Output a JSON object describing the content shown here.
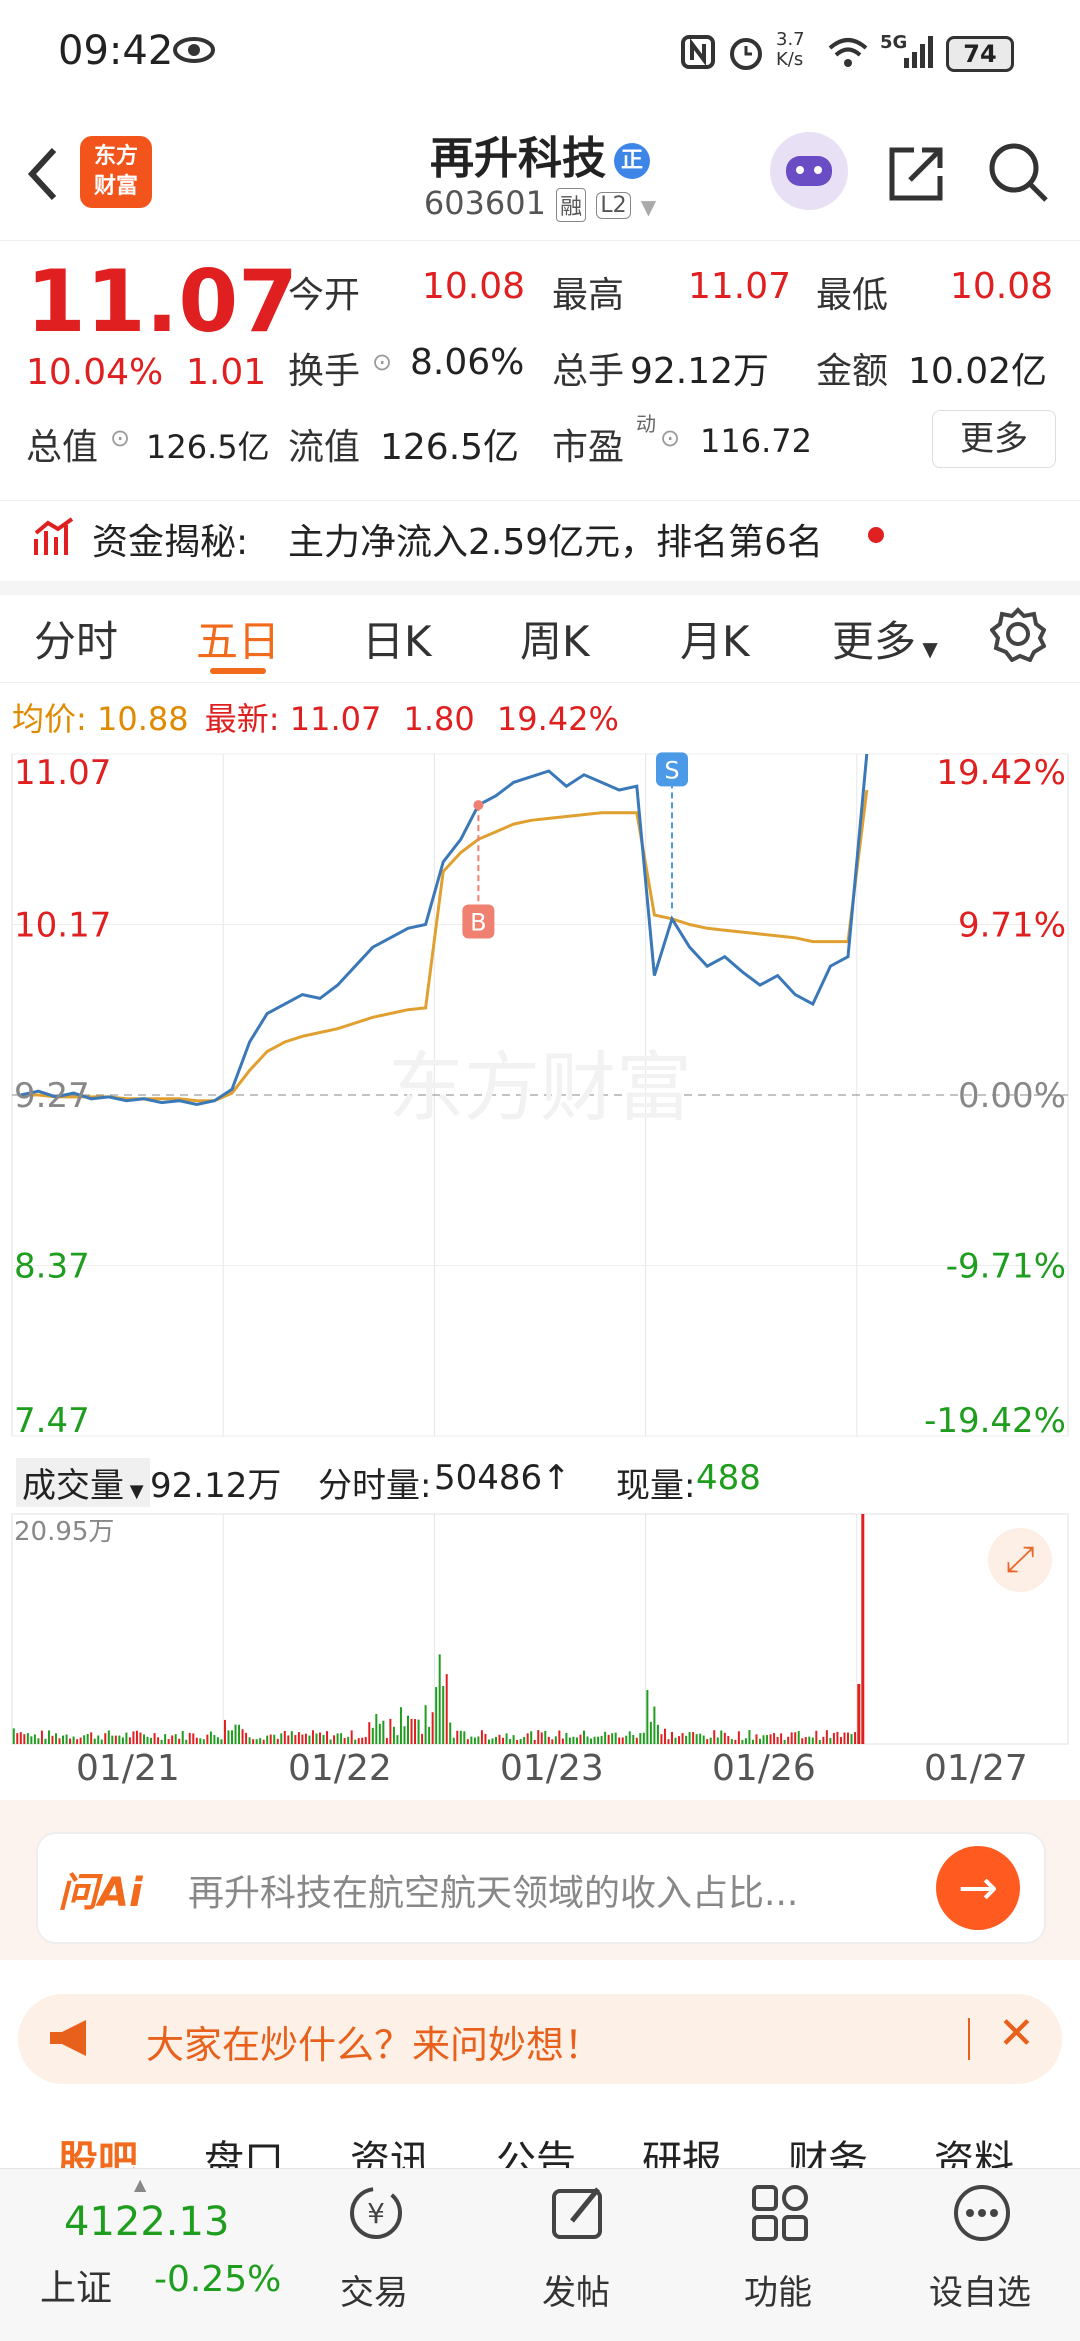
{
  "status": {
    "time": "09:42",
    "net_speed": "3.7\nK/s",
    "battery": "74",
    "signal": "5G"
  },
  "header": {
    "name": "再升科技",
    "badge": "正",
    "code": "603601",
    "tag_rong": "融",
    "tag_l2": "L2",
    "logo_line1": "东方",
    "logo_line2": "财富"
  },
  "quote": {
    "price": "11.07",
    "change_pct": "10.04%",
    "change": "1.01",
    "open_label": "今开",
    "open": "10.08",
    "high_label": "最高",
    "high": "11.07",
    "low_label": "最低",
    "low": "10.08",
    "turnover_label": "换手",
    "turnover": "8.06%",
    "volume_label": "总手",
    "volume": "92.12万",
    "amount_label": "金额",
    "amount": "10.02亿",
    "mktcap_label": "总值",
    "mktcap": "126.5亿",
    "float_label": "流值",
    "float": "126.5亿",
    "pe_label": "市盈",
    "pe_sup": "动",
    "pe": "116.72",
    "more": "更多"
  },
  "fund": {
    "label": "资金揭秘:",
    "text": "主力净流入2.59亿元，排名第6名"
  },
  "tabs": [
    "分时",
    "五日",
    "日K",
    "周K",
    "月K",
    "更多"
  ],
  "chart_info": {
    "avg_label": "均价:",
    "avg": "10.88",
    "last_label": "最新:",
    "last": "11.07",
    "chg": "1.80",
    "chg_pct": "19.42%"
  },
  "chart_data": {
    "type": "line",
    "x": [
      "01/21",
      "01/22",
      "01/23",
      "01/26",
      "01/27"
    ],
    "y_labels_left": [
      "11.07",
      "10.17",
      "9.27",
      "8.37",
      "7.47"
    ],
    "y_labels_right": [
      "19.42%",
      "9.71%",
      "0.00%",
      "-9.71%",
      "-19.42%"
    ],
    "ylim": [
      7.47,
      11.07
    ],
    "base": 9.27,
    "series": [
      {
        "name": "price",
        "values": [
          9.27,
          9.29,
          9.26,
          9.28,
          9.25,
          9.26,
          9.24,
          9.25,
          9.23,
          9.24,
          9.22,
          9.24,
          9.3,
          9.55,
          9.7,
          9.75,
          9.8,
          9.78,
          9.85,
          9.95,
          10.05,
          10.1,
          10.15,
          10.17,
          10.5,
          10.62,
          10.8,
          10.85,
          10.92,
          10.95,
          10.98,
          10.9,
          10.96,
          10.92,
          10.88,
          10.9,
          9.9,
          10.2,
          10.05,
          9.95,
          10.0,
          9.92,
          9.85,
          9.9,
          9.8,
          9.75,
          9.95,
          10.0,
          11.07
        ]
      },
      {
        "name": "avg",
        "values": [
          9.27,
          9.27,
          9.26,
          9.26,
          9.26,
          9.26,
          9.25,
          9.25,
          9.25,
          9.25,
          9.24,
          9.24,
          9.28,
          9.4,
          9.5,
          9.55,
          9.58,
          9.6,
          9.62,
          9.65,
          9.68,
          9.7,
          9.72,
          9.73,
          10.45,
          10.55,
          10.62,
          10.66,
          10.7,
          10.72,
          10.73,
          10.74,
          10.75,
          10.76,
          10.76,
          10.76,
          10.22,
          10.2,
          10.17,
          10.15,
          10.14,
          10.13,
          10.12,
          10.11,
          10.1,
          10.08,
          10.08,
          10.08,
          10.88
        ]
      }
    ],
    "markers": [
      {
        "label": "B",
        "color": "#f08070"
      },
      {
        "label": "S",
        "color": "#4a9ae8"
      }
    ],
    "watermark": "东方财富"
  },
  "volume": {
    "label": "成交量",
    "total": "92.12万",
    "min_label": "分时量:",
    "min_val": "50486↑",
    "now_label": "现量:",
    "now_val": "488",
    "max": "20.95万",
    "dates": [
      "01/21",
      "01/22",
      "01/23",
      "01/26",
      "01/27"
    ]
  },
  "ai": {
    "logo": "问Ai",
    "placeholder": "再升科技在航空航天领域的收入占比..."
  },
  "hot": {
    "text": "大家在炒什么？来问妙想！"
  },
  "nav_tabs": [
    "股吧",
    "盘口",
    "资讯",
    "公告",
    "研报",
    "财务",
    "资料"
  ],
  "bottom": {
    "index_value": "4122.13",
    "index_name": "上证",
    "index_change": "-0.25%",
    "items": [
      "交易",
      "发帖",
      "功能",
      "设自选"
    ]
  },
  "colors": {
    "up": "#e02020",
    "down": "#1f9d1f",
    "accent": "#f26a1c",
    "avg_line": "#e0a030",
    "price_line": "#3a78b8"
  }
}
